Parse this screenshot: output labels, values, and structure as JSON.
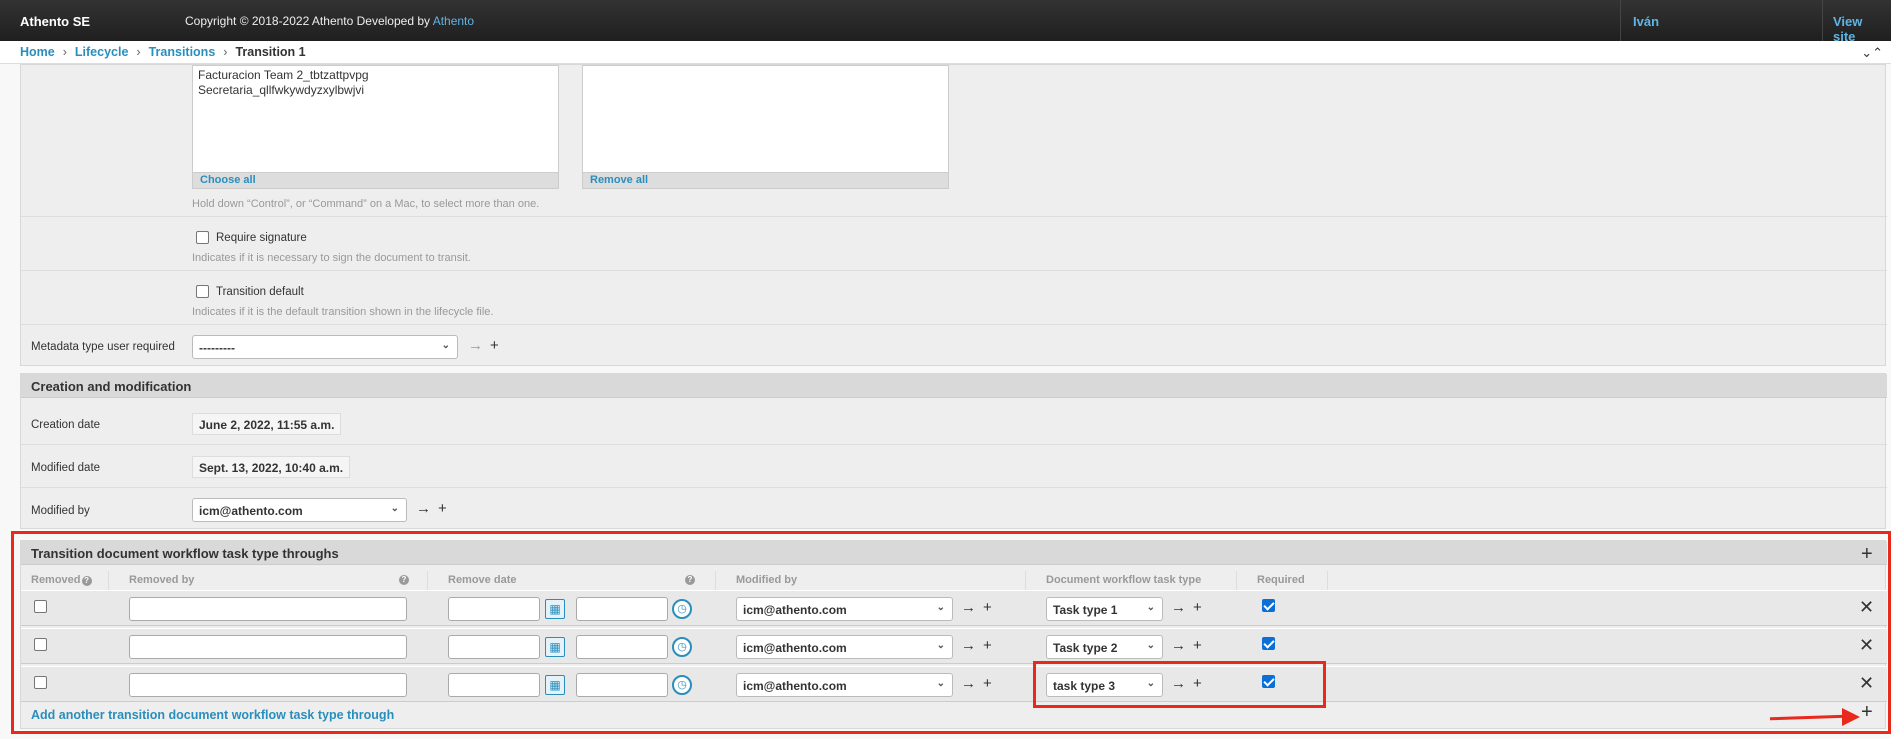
{
  "topbar": {
    "brand": "Athento SE",
    "copyright_prefix": "Copyright © 2018-2022 Athento Developed by ",
    "copyright_link": "Athento",
    "user": "Iván",
    "view_site": "View site"
  },
  "breadcrumbs": {
    "home": "Home",
    "lifecycle": "Lifecycle",
    "transitions": "Transitions",
    "current": "Transition 1",
    "sep": "›"
  },
  "groups_field": {
    "available": [
      "Facturacion Team 2_tbtzattpvpg",
      "Secretaria_qllfwkywdyzxylbwjvi"
    ],
    "choose_all": "Choose all",
    "remove_all": "Remove all",
    "help": "Hold down “Control”, or “Command” on a Mac, to select more than one."
  },
  "require_signature": {
    "label": "Require signature",
    "help": "Indicates if it is necessary to sign the document to transit.",
    "checked": false
  },
  "transition_default": {
    "label": "Transition default",
    "help": "Indicates if it is the default transition shown in the lifecycle file.",
    "checked": false
  },
  "metadata_type": {
    "label": "Metadata type user required",
    "value": "---------"
  },
  "creation": {
    "header": "Creation and modification",
    "creation_date_label": "Creation date",
    "creation_date": "June 2, 2022, 11:55 a.m.",
    "modified_date_label": "Modified date",
    "modified_date": "Sept. 13, 2022, 10:40 a.m.",
    "modified_by_label": "Modified by",
    "modified_by": "icm@athento.com"
  },
  "inline": {
    "header": "Transition document workflow task type throughs",
    "columns": {
      "removed": "Removed",
      "removed_by": "Removed by",
      "remove_date": "Remove date",
      "modified_by": "Modified by",
      "task_type": "Document workflow task type",
      "required": "Required"
    },
    "rows": [
      {
        "removed": false,
        "modified_by": "icm@athento.com",
        "task_type": "Task type 1",
        "required": true
      },
      {
        "removed": false,
        "modified_by": "icm@athento.com",
        "task_type": "Task type 2",
        "required": true
      },
      {
        "removed": false,
        "modified_by": "icm@athento.com",
        "task_type": "task type 3",
        "required": true
      }
    ],
    "add_link": "Add another transition document workflow task type through"
  },
  "icons": {
    "arrow": "→",
    "plus": "+",
    "close": "✕",
    "chevron": "⌄",
    "help": "?",
    "collapse": "⌄⌃"
  },
  "colors": {
    "link": "#2a8ebd",
    "annotation": "#e8291c",
    "checkbox": "#0b6fd6"
  }
}
